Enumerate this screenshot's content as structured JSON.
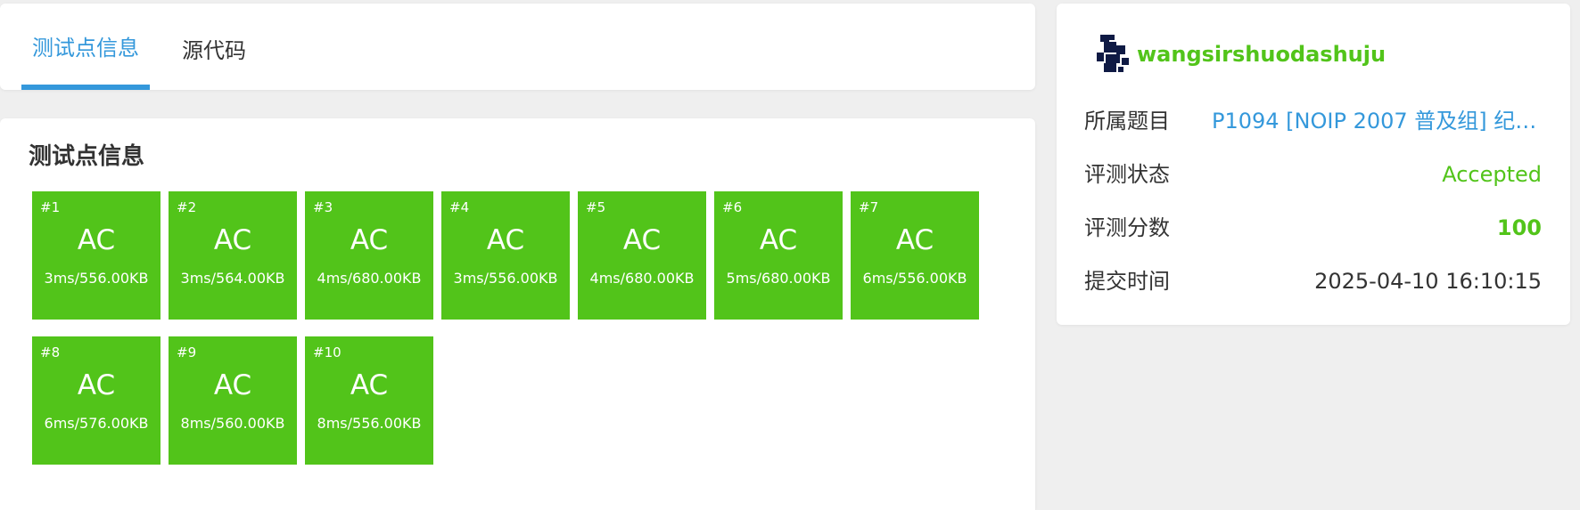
{
  "tabs": [
    {
      "label": "测试点信息",
      "active": true
    },
    {
      "label": "源代码",
      "active": false
    }
  ],
  "main": {
    "title": "测试点信息",
    "testcases": [
      {
        "num": "#1",
        "status": "AC",
        "meta": "3ms/556.00KB"
      },
      {
        "num": "#2",
        "status": "AC",
        "meta": "3ms/564.00KB"
      },
      {
        "num": "#3",
        "status": "AC",
        "meta": "4ms/680.00KB"
      },
      {
        "num": "#4",
        "status": "AC",
        "meta": "3ms/556.00KB"
      },
      {
        "num": "#5",
        "status": "AC",
        "meta": "4ms/680.00KB"
      },
      {
        "num": "#6",
        "status": "AC",
        "meta": "5ms/680.00KB"
      },
      {
        "num": "#7",
        "status": "AC",
        "meta": "6ms/556.00KB"
      },
      {
        "num": "#8",
        "status": "AC",
        "meta": "6ms/576.00KB"
      },
      {
        "num": "#9",
        "status": "AC",
        "meta": "8ms/560.00KB"
      },
      {
        "num": "#10",
        "status": "AC",
        "meta": "8ms/556.00KB"
      }
    ]
  },
  "side": {
    "username": "wangsirshuodashuju",
    "problem_label": "所属题目",
    "problem_value": "P1094 [NOIP 2007 普及组] 纪念...",
    "status_label": "评测状态",
    "status_value": "Accepted",
    "score_label": "评测分数",
    "score_value": "100",
    "time_label": "提交时间",
    "time_value": "2025-04-10 16:10:15"
  },
  "colors": {
    "accent": "#3498db",
    "ac_green": "#52c41a",
    "background": "#efefef",
    "avatar": "#0f1a44"
  },
  "icons": {
    "avatar": "pixel-identicon"
  }
}
